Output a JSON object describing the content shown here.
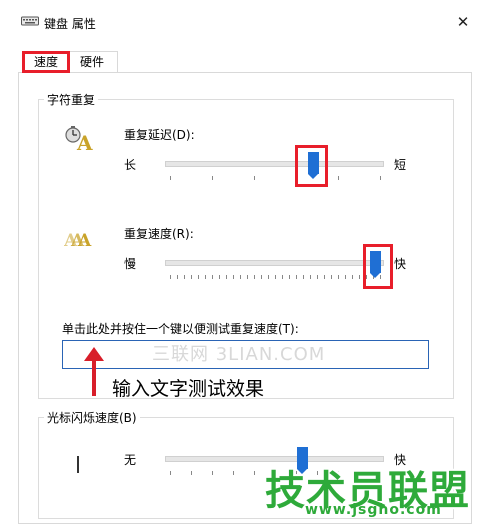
{
  "window": {
    "title": "键盘 属性",
    "close_glyph": "✕"
  },
  "tabs": [
    {
      "label": "速度",
      "active": true
    },
    {
      "label": "硬件",
      "active": false
    }
  ],
  "char_repeat": {
    "group_label": "字符重复",
    "delay": {
      "label": "重复延迟(D):",
      "min_label": "长",
      "max_label": "短",
      "value": 0.68
    },
    "rate": {
      "label": "重复速度(R):",
      "min_label": "慢",
      "max_label": "快",
      "value": 0.97
    },
    "test_label": "单击此处并按住一个键以便测试重复速度(T):",
    "test_value": "",
    "watermark": "三联网 3LIAN.COM"
  },
  "annotation": {
    "text": "输入文字测试效果",
    "color": "#d81e2a"
  },
  "cursor_blink": {
    "group_label": "光标闪烁速度(B)",
    "min_label": "无",
    "max_label": "快",
    "value": 0.63
  },
  "branding": {
    "logo_text": "技术员联盟",
    "url": "www.jsgho.com"
  },
  "colors": {
    "accent": "#1f6fd4",
    "highlight": "#e81e2a",
    "logo": "#2eaa3a"
  }
}
